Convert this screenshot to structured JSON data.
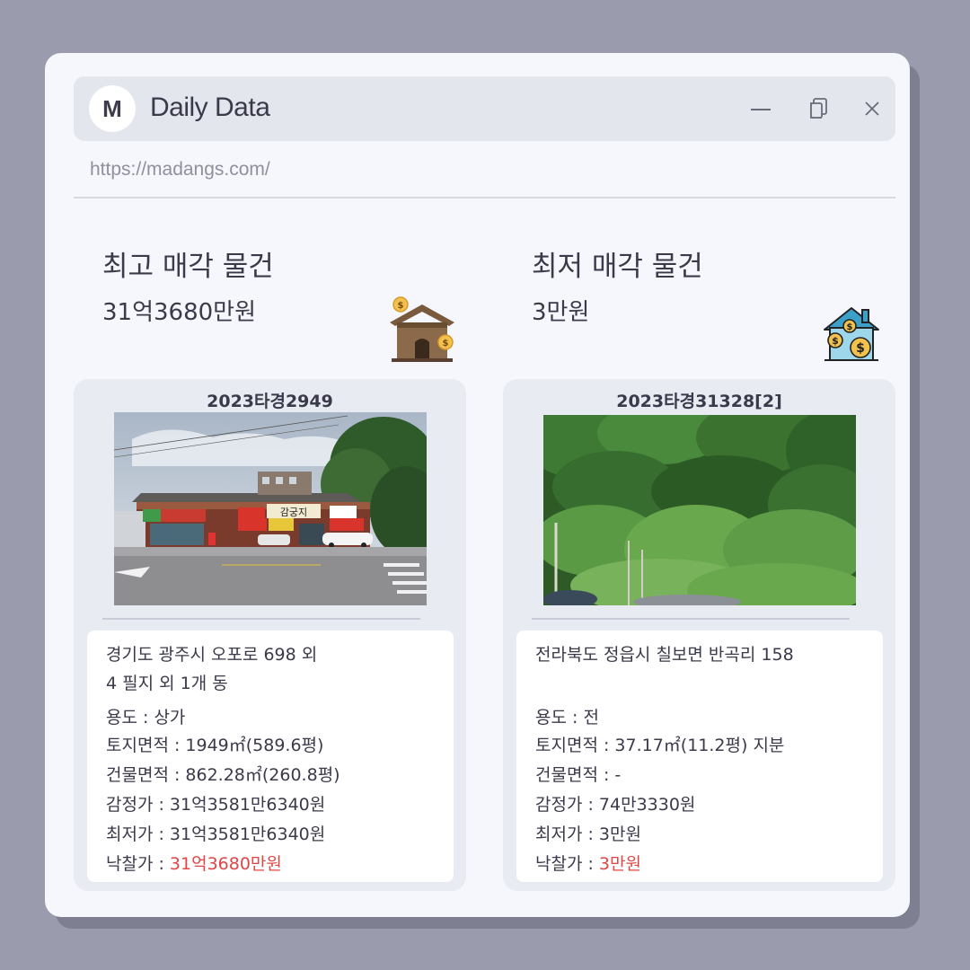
{
  "window": {
    "logo_letter": "M",
    "title": "Daily Data",
    "url": "https://madangs.com/"
  },
  "highest": {
    "heading": "최고 매각 물건",
    "price": "31억3680만원",
    "case_no": "2023타경2949",
    "address_line1": "경기도 광주시 오포로 698 외",
    "address_line2": "4 필지 외 1개 동",
    "usage": "용도 : 상가",
    "land_area": "토지면적 : 1949㎡(589.6평)",
    "building_area": "건물면적 : 862.28㎡(260.8평)",
    "appraisal": "감정가 : 31억3581만6340원",
    "minimum": "최저가 : 31억3581만6340원",
    "winning_label": "낙찰가 : ",
    "winning_value": "31억3680만원",
    "store_sign": "감궁지"
  },
  "lowest": {
    "heading": "최저 매각 물건",
    "price": "3만원",
    "case_no": "2023타경31328[2]",
    "address_line1": "전라북도 정읍시 칠보면 반곡리 158",
    "usage": "용도 : 전",
    "land_area": "토지면적 : 37.17㎡(11.2평) 지분",
    "building_area": "건물면적 : -",
    "appraisal": "감정가 : 74만3330원",
    "minimum": "최저가 : 3만원",
    "winning_label": "낙찰가 : ",
    "winning_value": "3만원"
  },
  "icons": {
    "minimize": "minimize-icon",
    "copy": "copy-icon",
    "close": "close-icon",
    "house_money_brown": "house-money-icon",
    "house_money_blue": "house-coins-icon"
  },
  "colors": {
    "accent_red": "#e04646",
    "background": "#9a9cae",
    "window": "#f6f7fc",
    "card": "#e9ebf3"
  }
}
